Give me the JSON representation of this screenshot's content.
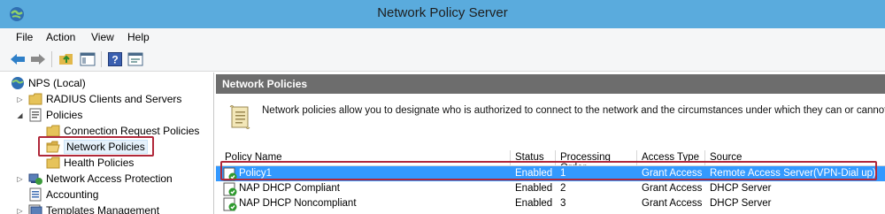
{
  "window": {
    "title": "Network Policy Server"
  },
  "menu": [
    "File",
    "Action",
    "View",
    "Help"
  ],
  "toolbar": {
    "buttons": [
      "back-icon",
      "forward-icon",
      "up-folder-icon",
      "show-hide-tree-icon",
      "help-icon",
      "properties-icon"
    ]
  },
  "tree": {
    "root": "NPS (Local)",
    "items": [
      {
        "label": "RADIUS Clients and Servers",
        "expander": "▷"
      },
      {
        "label": "Policies",
        "expander": "◢"
      },
      {
        "label": "Connection Request Policies"
      },
      {
        "label": "Network Policies",
        "selected": true
      },
      {
        "label": "Health Policies"
      },
      {
        "label": "Network Access Protection",
        "expander": "▷"
      },
      {
        "label": "Accounting"
      },
      {
        "label": "Templates Management",
        "expander": "▷"
      }
    ]
  },
  "pane": {
    "header": "Network Policies",
    "description": "Network policies allow you to designate who is authorized to connect to the network and the circumstances under which they can or cannot connect."
  },
  "grid": {
    "columns": [
      "Policy Name",
      "Status",
      "Processing Order",
      "Access Type",
      "Source"
    ],
    "rows": [
      [
        "Policy1",
        "Enabled",
        "1",
        "Grant Access",
        "Remote Access Server(VPN-Dial up)"
      ],
      [
        "NAP DHCP Compliant",
        "Enabled",
        "2",
        "Grant Access",
        "DHCP Server"
      ],
      [
        "NAP DHCP Noncompliant",
        "Enabled",
        "3",
        "Grant Access",
        "DHCP Server"
      ]
    ],
    "selected_row": 0
  },
  "colors": {
    "titlebar": "#5aabdd",
    "selection": "#3399ff",
    "highlight_box": "#b0283a",
    "pane_header": "#6d6d6d"
  }
}
